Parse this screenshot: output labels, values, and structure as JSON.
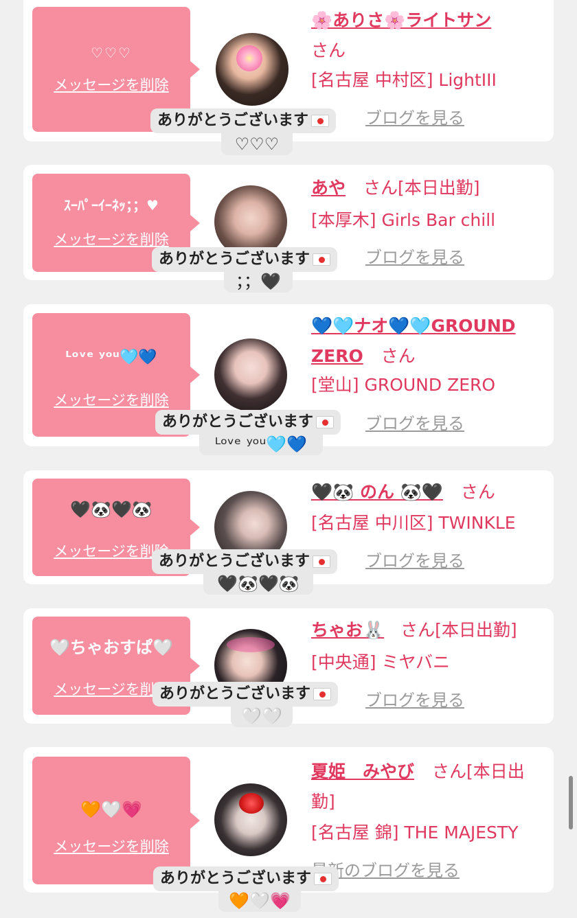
{
  "common": {
    "delete_label": "メッセージを削除",
    "blog_label": "ブログを見る",
    "blog_label_full": "最新のブログを見る",
    "thanks_label": "ありがとうございます",
    "san": "さん"
  },
  "cards": [
    {
      "bubble_message": "♡♡♡",
      "name": "🌸ありさ🌸ライトサン",
      "suffix": "さん",
      "shop": "[名古屋 中村区] LightIII",
      "reply_extra": "♡♡♡"
    },
    {
      "bubble_message": "ｽｰﾊﾟｰｲｰﾈｯ；；♥",
      "name": "あや",
      "suffix": "さん[本日出勤]",
      "shop": "[本厚木] Girls Bar chill",
      "reply_extra": "；；🖤"
    },
    {
      "bubble_message": "ᴸᵒᵛᵉ ʸᵒᵘ🩵💙",
      "name": "💙🩵ナオ💙🩵GROUND ZERO",
      "suffix": "さん",
      "shop": "[堂山] GROUND ZERO",
      "reply_extra": "ᴸᵒᵛᵉ ʸᵒᵘ🩵💙"
    },
    {
      "bubble_message": "🖤🐼🖤🐼",
      "name": "🖤🐼 のん 🐼🖤",
      "suffix": "さん",
      "shop": "[名古屋 中川区] TWINKLE",
      "reply_extra": "🖤🐼🖤🐼"
    },
    {
      "bubble_message": "🤍ちゃおすぱ🤍",
      "name": "ちゃお🐰",
      "suffix": "さん[本日出勤]",
      "shop": "[中央通] ミヤバニ",
      "reply_extra": "🤍🤍"
    },
    {
      "bubble_message": "🧡🤍💗",
      "name": "夏姫　みやび",
      "suffix": "さん[本日出勤]",
      "shop": "[名古屋 錦] THE MAJESTY",
      "reply_extra": "🧡🤍💗"
    }
  ],
  "icons": {
    "mail": "envelope-heart-icon"
  },
  "colors": {
    "accent": "#e0385e",
    "bubble": "#f78ea0",
    "link_gray": "#9a9a9a",
    "background": "#f0f0f0"
  }
}
